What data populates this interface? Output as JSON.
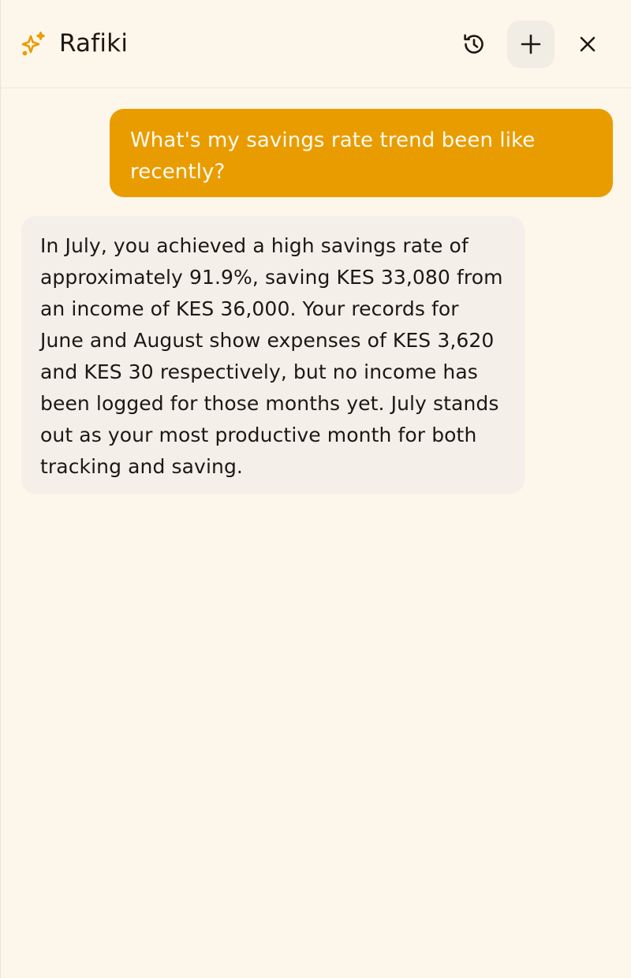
{
  "header": {
    "title": "Rafiki",
    "brand_icon": "sparkles-icon",
    "accent_color": "#e99c00",
    "buttons": {
      "history_icon": "history-icon",
      "new_chat_icon": "plus-icon",
      "close_icon": "close-icon"
    }
  },
  "conversation": {
    "messages": [
      {
        "role": "user",
        "text": "What's my savings rate trend been like recently?"
      },
      {
        "role": "assistant",
        "text": "In July, you achieved a high savings rate of approximately 91.9%, saving KES 33,080 from an income of KES 36,000. Your records for June and August show expenses of KES 3,620 and KES 30 respectively, but no income has been logged for those months yet. July stands out as your most productive month for both tracking and saving."
      }
    ]
  },
  "colors": {
    "background": "#fdf6ea",
    "user_bubble": "#e99c00",
    "assistant_bubble": "#f4efe8"
  }
}
